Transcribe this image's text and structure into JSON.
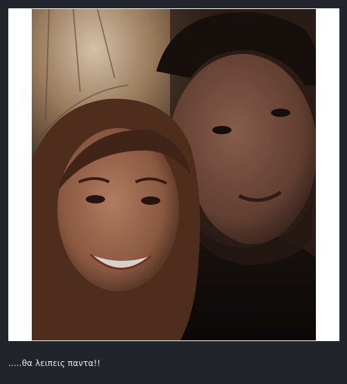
{
  "post": {
    "caption": ".....θα λειπεις παντα!!"
  },
  "photo": {
    "subject": "selfie-photo"
  },
  "colors": {
    "page_background": "#21252b",
    "frame_background": "#ffffff",
    "caption_text": "#e6e6e6"
  }
}
